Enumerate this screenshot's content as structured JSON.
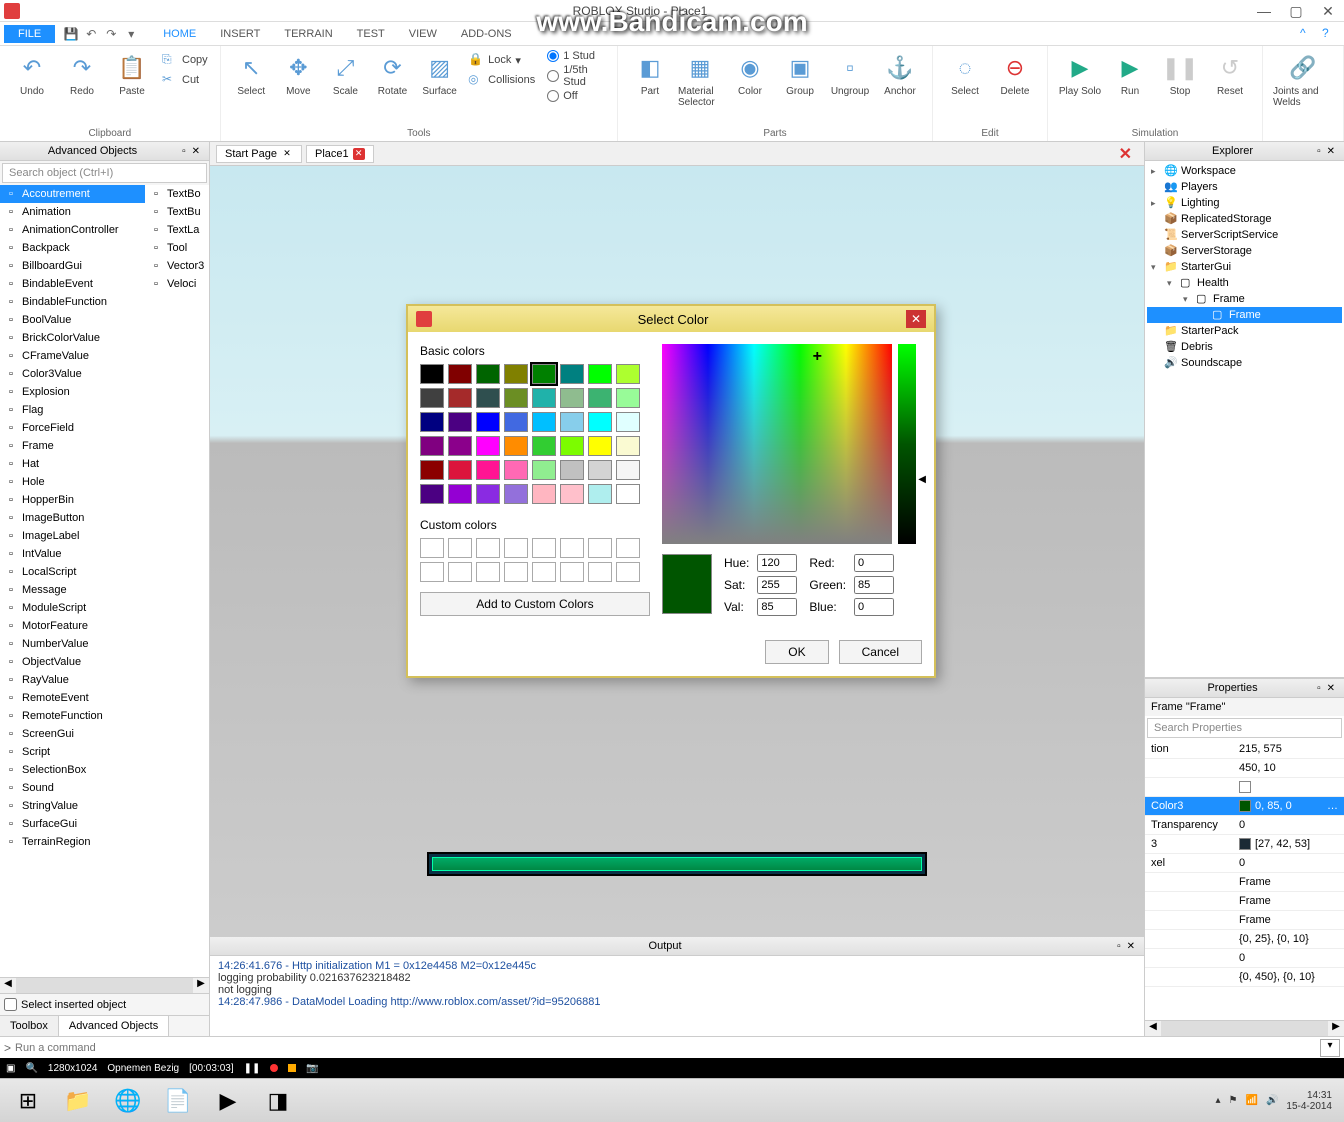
{
  "watermark": "www.Bandicam.com",
  "window": {
    "title": "ROBLOX Studio - Place1"
  },
  "menu": {
    "file": "FILE",
    "tabs": [
      "HOME",
      "INSERT",
      "TERRAIN",
      "TEST",
      "VIEW",
      "ADD-ONS"
    ],
    "active": "HOME"
  },
  "ribbon": {
    "clipboard": {
      "label": "Clipboard",
      "undo": "Undo",
      "redo": "Redo",
      "paste": "Paste",
      "copy": "Copy",
      "cut": "Cut"
    },
    "tools": {
      "label": "Tools",
      "select": "Select",
      "move": "Move",
      "scale": "Scale",
      "rotate": "Rotate",
      "surface": "Surface",
      "lock": "Lock",
      "collisions": "Collisions",
      "radio": [
        "1 Stud",
        "1/5th Stud",
        "Off"
      ],
      "radio_sel": 0
    },
    "parts": {
      "label": "Parts",
      "part": "Part",
      "matsel": "Material Selector",
      "color": "Color",
      "group": "Group",
      "ungroup": "Ungroup",
      "anchor": "Anchor"
    },
    "edit": {
      "label": "Edit",
      "selectbtn": "Select",
      "delete": "Delete"
    },
    "sim": {
      "label": "Simulation",
      "play": "Play Solo",
      "run": "Run",
      "stop": "Stop",
      "reset": "Reset"
    },
    "joints": {
      "label": "",
      "joints": "Joints and Welds"
    }
  },
  "advobj": {
    "title": "Advanced Objects",
    "search": "Search object (Ctrl+I)",
    "col1": [
      "Accoutrement",
      "Animation",
      "AnimationController",
      "Backpack",
      "BillboardGui",
      "BindableEvent",
      "BindableFunction",
      "BoolValue",
      "BrickColorValue",
      "CFrameValue",
      "Color3Value",
      "Explosion",
      "Flag",
      "ForceField",
      "Frame",
      "Hat",
      "Hole",
      "HopperBin",
      "ImageButton",
      "ImageLabel",
      "IntValue",
      "LocalScript",
      "Message",
      "ModuleScript",
      "MotorFeature",
      "NumberValue",
      "ObjectValue",
      "RayValue",
      "RemoteEvent",
      "RemoteFunction",
      "ScreenGui",
      "Script",
      "SelectionBox",
      "Sound",
      "StringValue",
      "SurfaceGui",
      "TerrainRegion"
    ],
    "col2": [
      "TextBo",
      "TextBu",
      "TextLa",
      "Tool",
      "Vector3",
      "Veloci"
    ],
    "selins": "Select inserted object",
    "tabs": {
      "toolbox": "Toolbox",
      "adv": "Advanced Objects"
    }
  },
  "doctabs": {
    "start": "Start Page",
    "place": "Place1"
  },
  "output": {
    "title": "Output",
    "lines": [
      {
        "t": "14:26:41.676 - Http initialization M1 = 0x12e4458 M2=0x12e445c",
        "k": "link"
      },
      {
        "t": "logging probability 0.021637623218482",
        "k": "plain"
      },
      {
        "t": "not logging",
        "k": "plain"
      },
      {
        "t": "14:28:47.986 - DataModel Loading http://www.roblox.com/asset/?id=95206881",
        "k": "link"
      }
    ]
  },
  "explorer": {
    "title": "Explorer",
    "nodes": [
      {
        "name": "Workspace",
        "indent": 0,
        "caret": "▸",
        "ico": "🌐"
      },
      {
        "name": "Players",
        "indent": 0,
        "caret": "",
        "ico": "👥"
      },
      {
        "name": "Lighting",
        "indent": 0,
        "caret": "▸",
        "ico": "💡"
      },
      {
        "name": "ReplicatedStorage",
        "indent": 0,
        "caret": "",
        "ico": "📦"
      },
      {
        "name": "ServerScriptService",
        "indent": 0,
        "caret": "",
        "ico": "📜"
      },
      {
        "name": "ServerStorage",
        "indent": 0,
        "caret": "",
        "ico": "📦"
      },
      {
        "name": "StarterGui",
        "indent": 0,
        "caret": "▾",
        "ico": "📁"
      },
      {
        "name": "Health",
        "indent": 1,
        "caret": "▾",
        "ico": "▢"
      },
      {
        "name": "Frame",
        "indent": 2,
        "caret": "▾",
        "ico": "▢"
      },
      {
        "name": "Frame",
        "indent": 3,
        "caret": "",
        "ico": "▢",
        "sel": true
      },
      {
        "name": "StarterPack",
        "indent": 0,
        "caret": "",
        "ico": "📁"
      },
      {
        "name": "Debris",
        "indent": 0,
        "caret": "",
        "ico": "🗑"
      },
      {
        "name": "Soundscape",
        "indent": 0,
        "caret": "",
        "ico": "🔊"
      }
    ]
  },
  "props": {
    "title": "Properties",
    "subtitle": "Frame \"Frame\"",
    "search": "Search Properties",
    "rows": [
      {
        "k": "tion",
        "v": "215, 575"
      },
      {
        "k": "",
        "v": "450, 10"
      },
      {
        "k": "",
        "v": "",
        "sw": "#fff"
      },
      {
        "k": "Color3",
        "v": "0, 85, 0",
        "sw": "#005500",
        "sel": true
      },
      {
        "k": "Transparency",
        "v": "0"
      },
      {
        "k": "3",
        "v": "[27, 42, 53]",
        "sw": "#1b2a35"
      },
      {
        "k": "xel",
        "v": "0"
      },
      {
        "k": "",
        "v": "Frame"
      },
      {
        "k": "",
        "v": "Frame"
      },
      {
        "k": "",
        "v": "Frame"
      },
      {
        "k": "",
        "v": "{0, 25}, {0, 10}"
      },
      {
        "k": "",
        "v": "0"
      },
      {
        "k": "",
        "v": "{0, 450}, {0, 10}"
      }
    ]
  },
  "cmdbar": {
    "placeholder": "Run a command"
  },
  "recbar": {
    "res": "1280x1024",
    "status": "Opnemen Bezig",
    "time": "[00:03:03]"
  },
  "taskbar": {
    "time": "14:31",
    "date": "15-4-2014"
  },
  "dialog": {
    "title": "Select Color",
    "basic": "Basic colors",
    "custom": "Custom colors",
    "addcustom": "Add to Custom Colors",
    "ok": "OK",
    "cancel": "Cancel",
    "hue_l": "Hue:",
    "sat_l": "Sat:",
    "val_l": "Val:",
    "red_l": "Red:",
    "green_l": "Green:",
    "blue_l": "Blue:",
    "hue": "120",
    "sat": "255",
    "val": "85",
    "red": "0",
    "green": "85",
    "blue": "0",
    "basic_colors": [
      "#000000",
      "#800000",
      "#006400",
      "#808000",
      "#008000",
      "#008080",
      "#00ff00",
      "#adff2f",
      "#404040",
      "#a52a2a",
      "#2f4f4f",
      "#6b8e23",
      "#20b2aa",
      "#8fbc8f",
      "#3cb371",
      "#98fb98",
      "#000080",
      "#4b0082",
      "#0000ff",
      "#4169e1",
      "#00bfff",
      "#87ceeb",
      "#00ffff",
      "#e0ffff",
      "#800080",
      "#8b008b",
      "#ff00ff",
      "#ff8c00",
      "#32cd32",
      "#7cfc00",
      "#ffff00",
      "#fafad2",
      "#8b0000",
      "#dc143c",
      "#ff1493",
      "#ff69b4",
      "#90ee90",
      "#c0c0c0",
      "#d3d3d3",
      "#f5f5f5",
      "#4b0082",
      "#9400d3",
      "#8a2be2",
      "#9370db",
      "#ffb6c1",
      "#ffc0cb",
      "#afeeee",
      "#ffffff"
    ],
    "sel_idx": 4
  }
}
